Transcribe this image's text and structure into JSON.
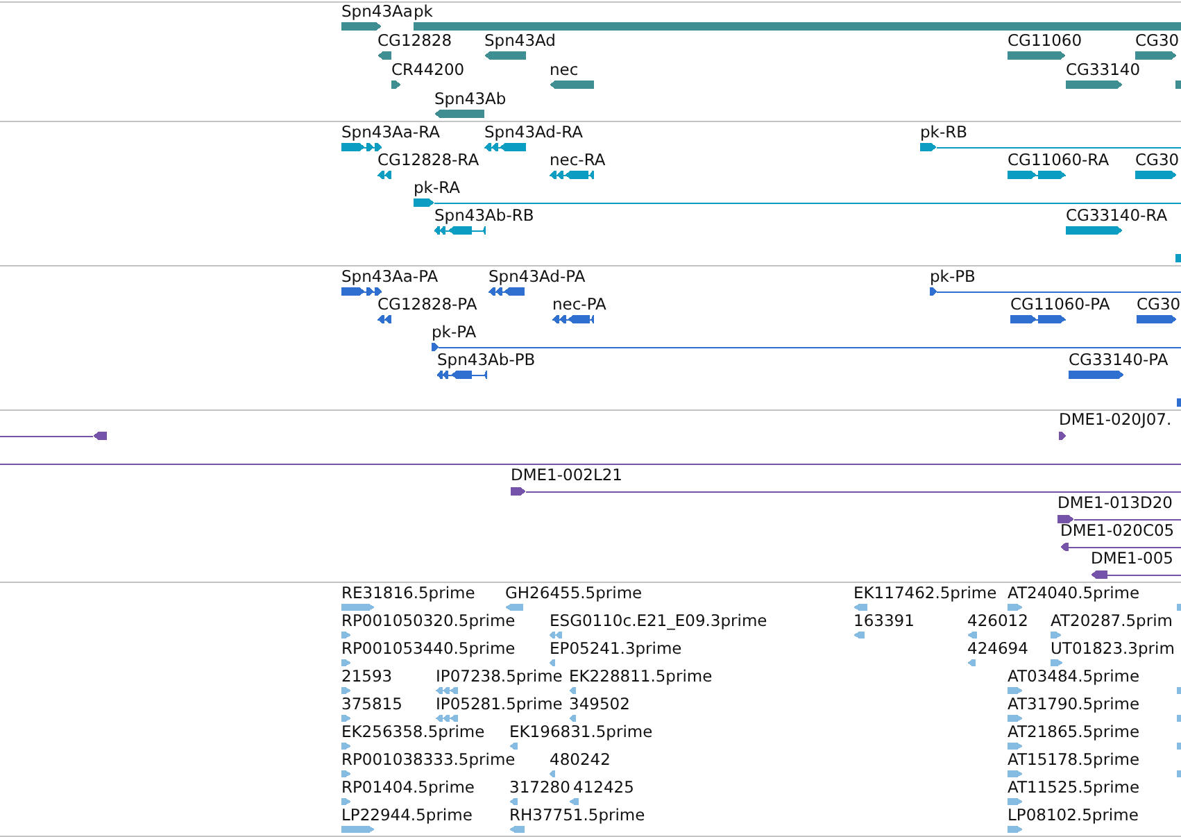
{
  "tracks": [
    {
      "color": "#3f8e92",
      "features": [
        {
          "label": "Spn43Aa",
          "kind": "block",
          "reverse": false
        },
        {
          "label": "pk",
          "kind": "bar"
        },
        {
          "label": "CG12828",
          "kind": "block",
          "reverse": true
        },
        {
          "label": "Spn43Ad",
          "kind": "block",
          "reverse": true
        },
        {
          "label": "CG11060",
          "kind": "block",
          "reverse": false
        },
        {
          "label": "CG30",
          "kind": "block",
          "reverse": false
        },
        {
          "label": "CR44200",
          "kind": "block",
          "reverse": false
        },
        {
          "label": "nec",
          "kind": "block",
          "reverse": true
        },
        {
          "label": "CG33140",
          "kind": "block",
          "reverse": false
        },
        {
          "kind": "bar"
        },
        {
          "label": "Spn43Ab",
          "kind": "block",
          "reverse": true
        }
      ]
    },
    {
      "color": "#0c9dc3",
      "features": [
        {
          "label": "Spn43Aa-RA",
          "kind": "spliced",
          "reverse": false
        },
        {
          "label": "Spn43Ad-RA",
          "kind": "spliced",
          "reverse": true
        },
        {
          "label": "pk-RB",
          "kind": "span",
          "reverse": false
        },
        {
          "label": "CG12828-RA",
          "kind": "spliced",
          "reverse": true
        },
        {
          "label": "nec-RA",
          "kind": "spliced",
          "reverse": true
        },
        {
          "label": "CG11060-RA",
          "kind": "spliced",
          "reverse": false
        },
        {
          "label": "CG30",
          "kind": "block",
          "reverse": false
        },
        {
          "label": "pk-RA",
          "kind": "span",
          "reverse": false
        },
        {
          "label": "Spn43Ab-RB",
          "kind": "spliced",
          "reverse": true
        },
        {
          "label": "CG33140-RA",
          "kind": "block",
          "reverse": false
        },
        {
          "kind": "bar"
        }
      ]
    },
    {
      "color": "#2f6fd0",
      "features": [
        {
          "label": "Spn43Aa-PA",
          "kind": "spliced",
          "reverse": false
        },
        {
          "label": "Spn43Ad-PA",
          "kind": "spliced",
          "reverse": true
        },
        {
          "label": "pk-PB",
          "kind": "span",
          "reverse": false
        },
        {
          "label": "CG12828-PA",
          "kind": "spliced",
          "reverse": true
        },
        {
          "label": "nec-PA",
          "kind": "spliced",
          "reverse": true
        },
        {
          "label": "CG11060-PA",
          "kind": "spliced",
          "reverse": false
        },
        {
          "label": "CG30",
          "kind": "block",
          "reverse": false
        },
        {
          "label": "pk-PA",
          "kind": "span",
          "reverse": false
        },
        {
          "label": "Spn43Ab-PB",
          "kind": "spliced",
          "reverse": true
        },
        {
          "label": "CG33140-PA",
          "kind": "block",
          "reverse": false
        },
        {
          "kind": "bar"
        }
      ]
    },
    {
      "color": "#7553a8",
      "features": [
        {
          "kind": "tail",
          "reverse": true
        },
        {
          "label": "DME1-020J07.",
          "kind": "block",
          "reverse": false
        },
        {
          "kind": "line"
        },
        {
          "label": "DME1-002L21",
          "kind": "span",
          "reverse": false
        },
        {
          "label": "DME1-013D20",
          "kind": "span",
          "reverse": false
        },
        {
          "label": "DME1-020C05",
          "kind": "span",
          "reverse": true
        },
        {
          "label": "DME1-005",
          "kind": "span",
          "reverse": true
        }
      ]
    },
    {
      "color": "#86bbe1",
      "features": [
        {
          "label": "RE31816.5prime",
          "kind": "block",
          "reverse": false
        },
        {
          "label": "GH26455.5prime",
          "kind": "block",
          "reverse": true
        },
        {
          "label": "EK117462.5prime",
          "kind": "block",
          "reverse": true
        },
        {
          "label": "AT24040.5prime",
          "kind": "block",
          "reverse": false
        },
        {
          "kind": "bar"
        },
        {
          "label": "RP001050320.5prime",
          "kind": "block",
          "reverse": false
        },
        {
          "label": "ESG0110c.E21_E09.3prime",
          "kind": "spliced",
          "reverse": true
        },
        {
          "label": "163391",
          "kind": "block",
          "reverse": true
        },
        {
          "label": "426012",
          "kind": "block",
          "reverse": true
        },
        {
          "label": "AT20287.5prim",
          "kind": "block",
          "reverse": false
        },
        {
          "label": "RP001053440.5prime",
          "kind": "block",
          "reverse": false
        },
        {
          "label": "EP05241.3prime",
          "kind": "block",
          "reverse": true
        },
        {
          "label": "424694",
          "kind": "block",
          "reverse": true
        },
        {
          "label": "UT01823.3prim",
          "kind": "block",
          "reverse": false
        },
        {
          "label": "21593",
          "kind": "block",
          "reverse": false
        },
        {
          "label": "IP07238.5prime",
          "kind": "spliced",
          "reverse": true
        },
        {
          "label": "EK228811.5prime",
          "kind": "block",
          "reverse": true
        },
        {
          "label": "AT03484.5prime",
          "kind": "block",
          "reverse": false
        },
        {
          "kind": "bar"
        },
        {
          "label": "375815",
          "kind": "block",
          "reverse": false
        },
        {
          "label": "IP05281.5prime",
          "kind": "spliced",
          "reverse": true
        },
        {
          "label": "349502",
          "kind": "block",
          "reverse": true
        },
        {
          "label": "AT31790.5prime",
          "kind": "block",
          "reverse": false
        },
        {
          "kind": "bar"
        },
        {
          "label": "EK256358.5prime",
          "kind": "block",
          "reverse": false
        },
        {
          "label": "EK196831.5prime",
          "kind": "block",
          "reverse": true
        },
        {
          "label": "AT21865.5prime",
          "kind": "block",
          "reverse": false
        },
        {
          "kind": "bar"
        },
        {
          "label": "RP001038333.5prime",
          "kind": "block",
          "reverse": false
        },
        {
          "label": "480242",
          "kind": "block",
          "reverse": true
        },
        {
          "label": "AT15178.5prime",
          "kind": "block",
          "reverse": false
        },
        {
          "kind": "bar"
        },
        {
          "label": "RP01404.5prime",
          "kind": "block",
          "reverse": false
        },
        {
          "label": "317280",
          "kind": "block",
          "reverse": true
        },
        {
          "label": "412425",
          "kind": "block",
          "reverse": true
        },
        {
          "label": "AT11525.5prime",
          "kind": "block",
          "reverse": false
        },
        {
          "label": "LP22944.5prime",
          "kind": "block",
          "reverse": false
        },
        {
          "label": "RH37751.5prime",
          "kind": "block",
          "reverse": true
        },
        {
          "label": "LP08102.5prime",
          "kind": "block",
          "reverse": false
        }
      ]
    }
  ]
}
